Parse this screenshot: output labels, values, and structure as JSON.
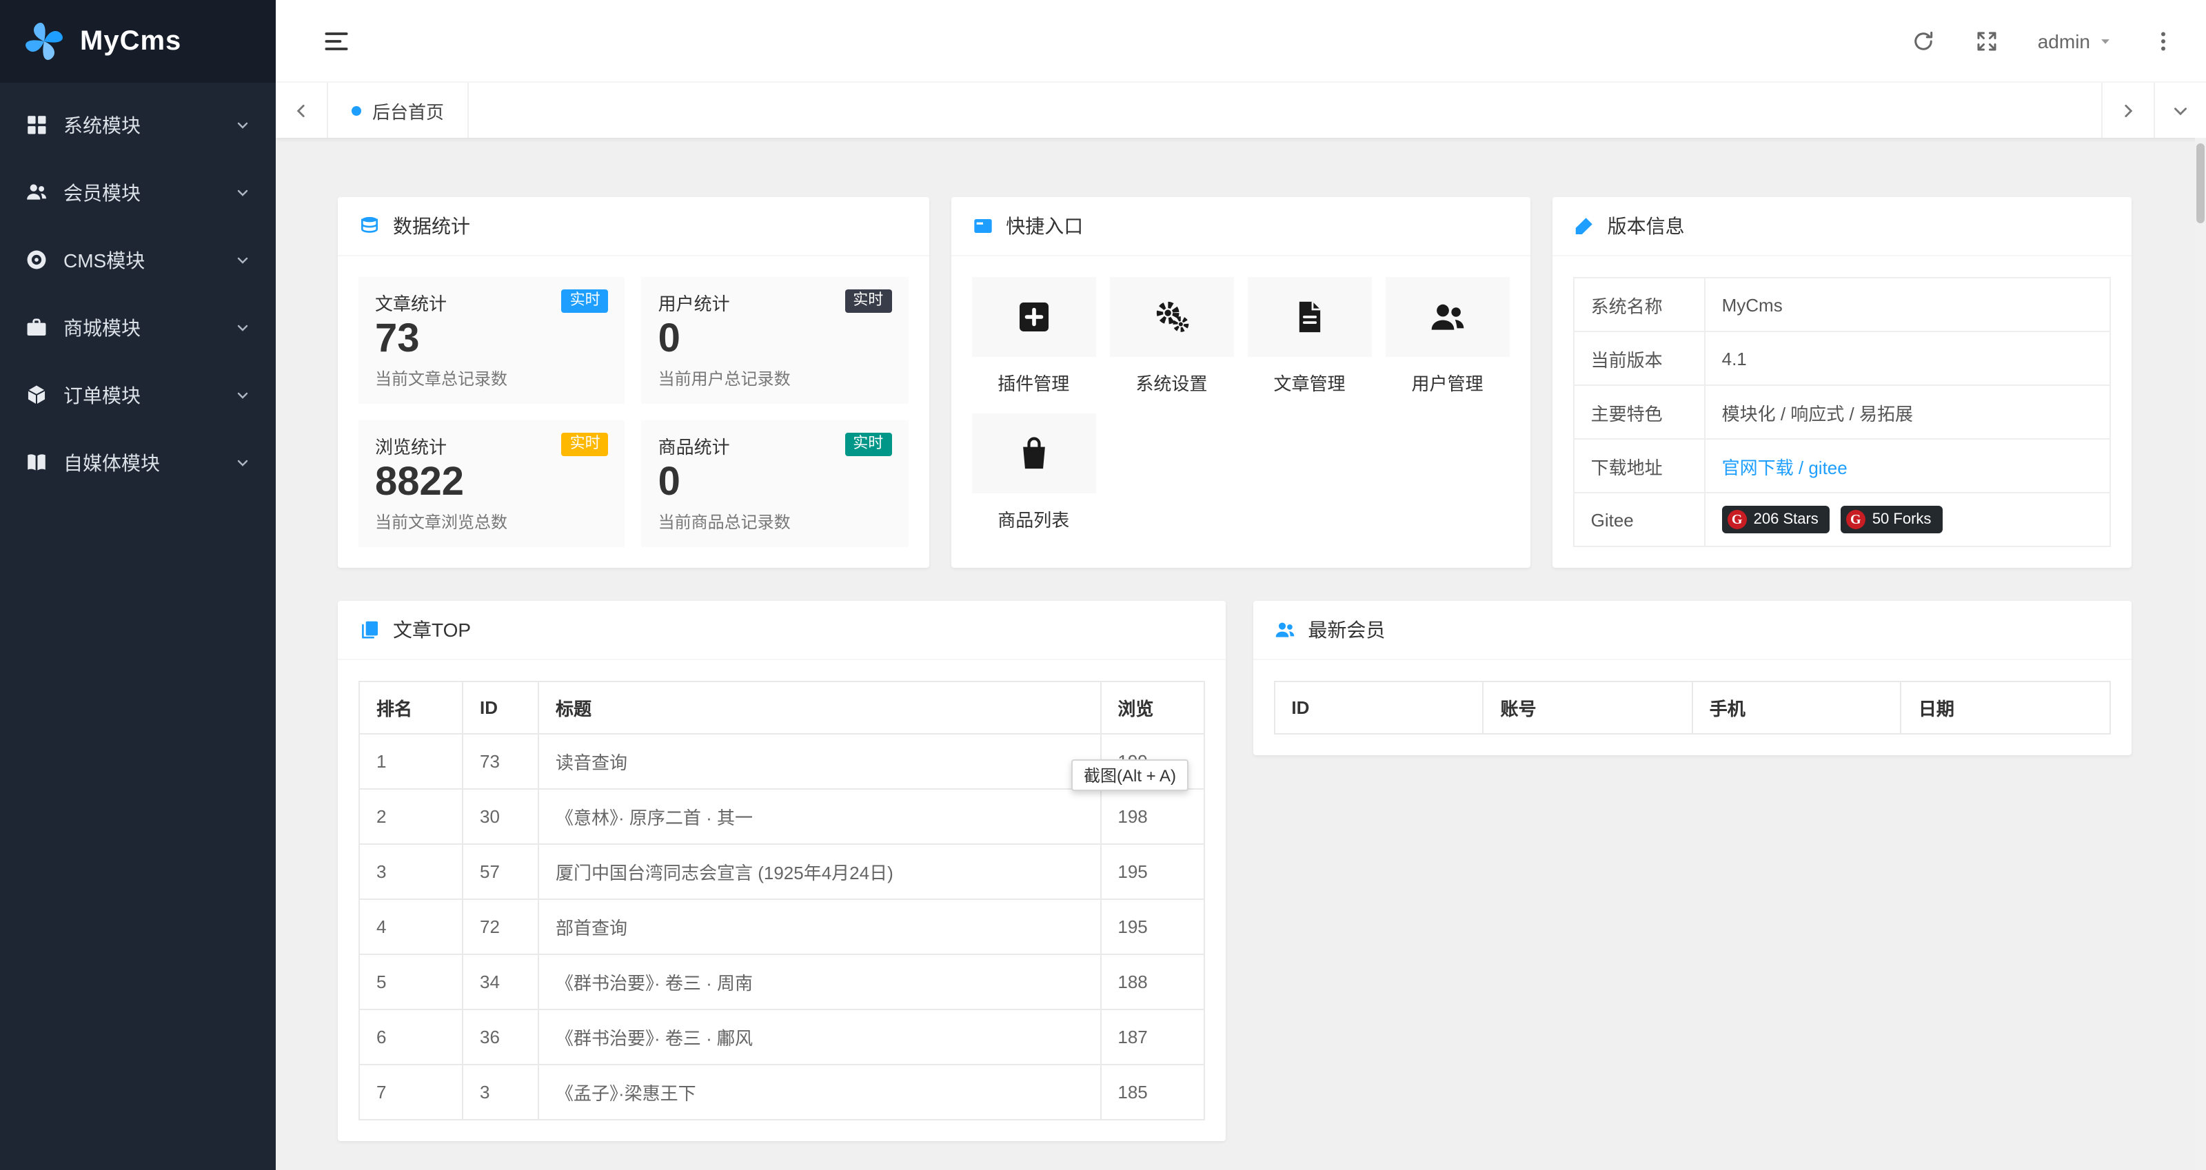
{
  "brand": {
    "title": "MyCms"
  },
  "sidebar": {
    "items": [
      {
        "label": "系统模块",
        "icon": "grid-icon"
      },
      {
        "label": "会员模块",
        "icon": "users-icon"
      },
      {
        "label": "CMS模块",
        "icon": "globe-icon"
      },
      {
        "label": "商城模块",
        "icon": "briefcase-icon"
      },
      {
        "label": "订单模块",
        "icon": "cube-icon"
      },
      {
        "label": "自媒体模块",
        "icon": "book-icon"
      }
    ]
  },
  "topbar": {
    "username": "admin"
  },
  "tabbar": {
    "active_tab": "后台首页"
  },
  "colors": {
    "accent": "#1E9FFF"
  },
  "stats_panel": {
    "title": "数据统计",
    "cards": [
      {
        "title": "文章统计",
        "badge": "实时",
        "badge_color": "#1E9FFF",
        "value": "73",
        "desc": "当前文章总记录数"
      },
      {
        "title": "用户统计",
        "badge": "实时",
        "badge_color": "#393D49",
        "value": "0",
        "desc": "当前用户总记录数"
      },
      {
        "title": "浏览统计",
        "badge": "实时",
        "badge_color": "#FFB800",
        "value": "8822",
        "desc": "当前文章浏览总数"
      },
      {
        "title": "商品统计",
        "badge": "实时",
        "badge_color": "#009688",
        "value": "0",
        "desc": "当前商品总记录数"
      }
    ]
  },
  "shortcuts_panel": {
    "title": "快捷入口",
    "items": [
      {
        "label": "插件管理",
        "icon": "plus-square-icon"
      },
      {
        "label": "系统设置",
        "icon": "gears-icon"
      },
      {
        "label": "文章管理",
        "icon": "file-text-icon"
      },
      {
        "label": "用户管理",
        "icon": "users-icon"
      },
      {
        "label": "商品列表",
        "icon": "shopping-bag-icon"
      }
    ]
  },
  "version_panel": {
    "title": "版本信息",
    "rows": {
      "name": {
        "label": "系统名称",
        "value": "MyCms"
      },
      "version": {
        "label": "当前版本",
        "value": "4.1"
      },
      "features": {
        "label": "主要特色",
        "value": "模块化 / 响应式 / 易拓展"
      },
      "download": {
        "label": "下载地址",
        "link_official": "官网下载",
        "separator": " / ",
        "link_gitee": "gitee"
      },
      "gitee": {
        "label": "Gitee",
        "stars": "206 Stars",
        "forks": "50 Forks",
        "logo": "G"
      }
    }
  },
  "article_panel": {
    "title": "文章TOP",
    "headers": [
      "排名",
      "ID",
      "标题",
      "浏览"
    ],
    "rows": [
      [
        "1",
        "73",
        "读音查询",
        "199"
      ],
      [
        "2",
        "30",
        "《意林》· 原序二首 · 其一",
        "198"
      ],
      [
        "3",
        "57",
        "厦门中国台湾同志会宣言 (1925年4月24日)",
        "195"
      ],
      [
        "4",
        "72",
        "部首查询",
        "195"
      ],
      [
        "5",
        "34",
        "《群书治要》· 卷三 · 周南",
        "188"
      ],
      [
        "6",
        "36",
        "《群书治要》· 卷三 · 鄘风",
        "187"
      ],
      [
        "7",
        "3",
        "《孟子》·梁惠王下",
        "185"
      ]
    ]
  },
  "members_panel": {
    "title": "最新会员",
    "headers": [
      "ID",
      "账号",
      "手机",
      "日期"
    ]
  },
  "tooltip": {
    "text": "截图(Alt + A)"
  }
}
